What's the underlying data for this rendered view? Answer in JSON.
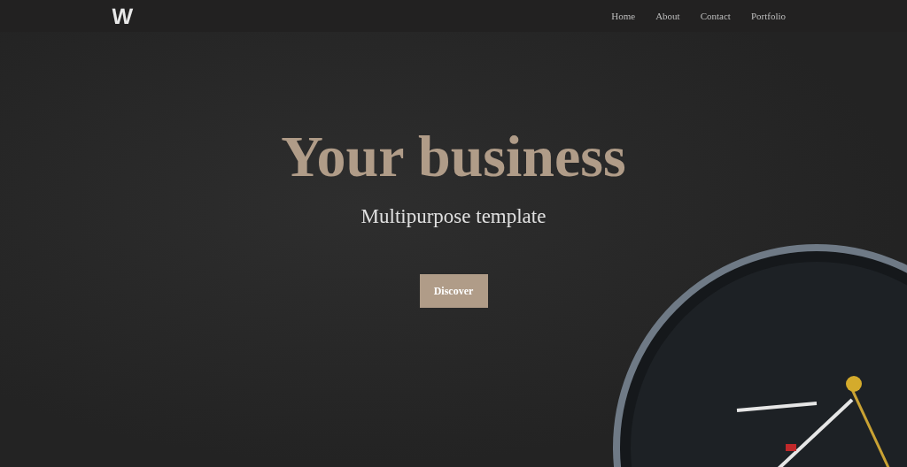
{
  "navbar": {
    "logo": "W",
    "links": [
      {
        "label": "Home"
      },
      {
        "label": "About"
      },
      {
        "label": "Contact"
      },
      {
        "label": "Portfolio"
      }
    ]
  },
  "hero": {
    "title": "Your business",
    "subtitle": "Multipurpose template",
    "button": "Discover"
  }
}
